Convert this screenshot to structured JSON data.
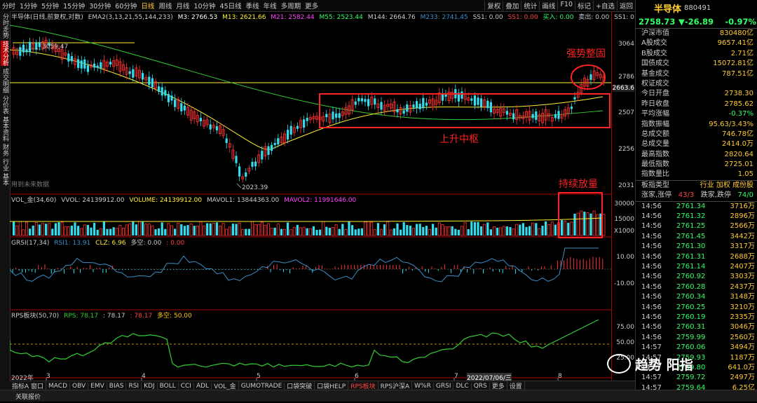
{
  "topbar": {
    "tabs": [
      "分时",
      "1分钟",
      "5分钟",
      "15分钟",
      "30分钟",
      "60分钟",
      "日线",
      "周线",
      "月线",
      "10分钟",
      "45日线",
      "季线",
      "年线",
      "多周期",
      "更多"
    ],
    "active": "日线",
    "right": [
      "复权",
      "叠加",
      "统计",
      "画线",
      "F10",
      "标记",
      "+自选",
      "返回"
    ]
  },
  "leftbar": [
    "分时走势",
    "技术分析",
    "成交明细",
    "分价表",
    "基本资料",
    "财务",
    "行业",
    "基本"
  ],
  "main_info": {
    "title": "半导体(日线,前复权,对数)",
    "ema_label": "EMA2(3,13,21,55,144,233)",
    "m3": "M3: 2766.53",
    "m13": "M13: 2621.66",
    "m21": "M21: 2582.44",
    "m55": "M55: 2523.44",
    "m144": "M144: 2664.76",
    "m233": "M233: 2741.45",
    "ss1": "SS1: 0.00",
    "ss1b": "SS1: 0.00",
    "buy": "买入: 0.00",
    "sell": "卖出: 0.00",
    "ss1c": "SS1: 0.00"
  },
  "price_axis": [
    "3064",
    "2786",
    "2663.6",
    "2507",
    "2256",
    "2031"
  ],
  "annotations": {
    "high_label": "3059.47",
    "low_label": "2023.39",
    "future": "用到未来数据",
    "a1": "强势整固",
    "a2": "上升中枢",
    "a3": "持续放量"
  },
  "vol_info": {
    "name": "VOL_金(34,60)",
    "vvol": "VVOL: 24139912.00",
    "volume": "VOLUME: 24139912.00",
    "mavol1": "MAVOL1: 13844363.00",
    "mavol2": "MAVOL2: 11991646.00",
    "axis": [
      "30000",
      "15000",
      "X1000"
    ]
  },
  "grsi_info": {
    "name": "GRSI(17,34)",
    "rsi1": "RSI1: 13.91",
    "clz": "CLZ: 6.96",
    "dk": "多空: 0.00",
    "x": ": 0.00",
    "axis": [
      "10.00",
      "-10.00"
    ]
  },
  "rps_info": {
    "name": "RPS板块(50,70)",
    "rps": "RPS: 78.17",
    "v2": ": 78.17",
    "v3": ": 78.17",
    "dk": "多空: 50.00",
    "axis": [
      "75.00",
      "50.00",
      "25.00"
    ]
  },
  "date_axis": [
    "2022年",
    "3",
    "4",
    "5",
    "6",
    "7",
    "2022/07/06/三",
    "8"
  ],
  "bottombar": [
    "指标A 窗口",
    "MACD",
    "OBV",
    "EMV",
    "BIAS",
    "RSI",
    "KDJ",
    "BOLL",
    "CCI",
    "ADL",
    "VOL_金",
    "GUMOTRADE",
    "口袋突破",
    "口袋HELP",
    "RPS板块",
    "RPS沪深A",
    "W%R",
    "GRSI",
    "DLC",
    "QRS",
    "更多",
    "设置"
  ],
  "bottom_active": "RPS板块",
  "right_panel": {
    "name": "半导体",
    "code": "880491",
    "price": "2758.73",
    "change": "▼-26.89",
    "pct": "-0.97%",
    "stats": [
      {
        "l": "沪深市值",
        "v": "830480亿"
      },
      {
        "l": "A股成交",
        "v": "9657.41亿"
      },
      {
        "l": "B股成交",
        "v": "2.71亿"
      },
      {
        "l": "国债成交",
        "v": "15072.81亿"
      },
      {
        "l": "基金成交",
        "v": "787.51亿"
      },
      {
        "l": "权证成交",
        "v": ""
      },
      {
        "l": "今日开盘",
        "v": "2738.30"
      },
      {
        "l": "昨日收盘",
        "v": "2785.62"
      },
      {
        "l": "平均涨幅",
        "v": "-0.37%"
      },
      {
        "l": "指数振幅",
        "v": "95.63/3.43%"
      },
      {
        "l": "总成交额",
        "v": "746.78亿"
      },
      {
        "l": "总成交量",
        "v": "2414.0万"
      },
      {
        "l": "最高指数",
        "v": "2820.64"
      },
      {
        "l": "最低指数",
        "v": "2725.01"
      },
      {
        "l": "指数量比",
        "v": "1.05"
      }
    ],
    "board_type_l": "板指类型",
    "board_type_v": "行业 加权 成份股",
    "zt_l": "涨家,涨停",
    "zt_v": "43/3",
    "dt_l": "跌家,跌停",
    "dt_v": "74/0",
    "ticks": [
      {
        "t": "14:56",
        "p": "2761.34",
        "v": "3716万"
      },
      {
        "t": "14:56",
        "p": "2761.32",
        "v": "2896万"
      },
      {
        "t": "14:56",
        "p": "2761.25",
        "v": "2566万"
      },
      {
        "t": "14:56",
        "p": "2761.45",
        "v": "3442万"
      },
      {
        "t": "14:56",
        "p": "2761.30",
        "v": "3317万"
      },
      {
        "t": "14:56",
        "p": "2761.31",
        "v": "2688万"
      },
      {
        "t": "14:56",
        "p": "2761.14",
        "v": "2407万"
      },
      {
        "t": "14:56",
        "p": "2760.92",
        "v": "3303万"
      },
      {
        "t": "14:56",
        "p": "2760.28",
        "v": "2437万"
      },
      {
        "t": "14:56",
        "p": "2760.34",
        "v": "3148万"
      },
      {
        "t": "14:56",
        "p": "2760.25",
        "v": "3210万"
      },
      {
        "t": "14:56",
        "p": "2760.19",
        "v": "2335万"
      },
      {
        "t": "14:56",
        "p": "2760.31",
        "v": "3046万"
      },
      {
        "t": "14:56",
        "p": "2759.99",
        "v": "2560万"
      },
      {
        "t": "14:57",
        "p": "2760.06",
        "v": "3494万"
      },
      {
        "t": "14:57",
        "p": "2759.93",
        "v": "1187万"
      },
      {
        "t": "14:57",
        "p": "2759.80",
        "v": "641.0万"
      },
      {
        "t": "14:57",
        "p": "2759.72",
        "v": "2497万"
      },
      {
        "t": "14:57",
        "p": "2759.64",
        "v": "6.25亿"
      },
      {
        "t": "15:00",
        "p": "2758.73",
        "v": "2.75亿"
      }
    ]
  },
  "watermark": "趋势 阳指",
  "status": "关联报价"
}
